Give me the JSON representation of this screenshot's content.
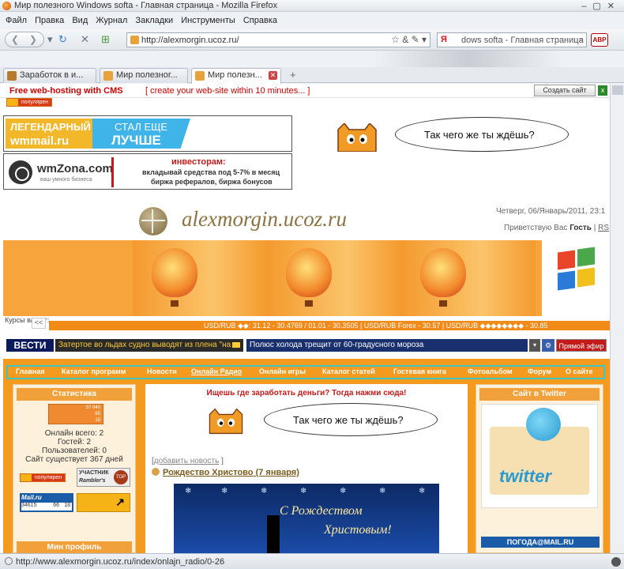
{
  "window": {
    "title": "Мир полезного Windows softa - Главная страница - Mozilla Firefox"
  },
  "menu": [
    "Файл",
    "Правка",
    "Вид",
    "Журнал",
    "Закладки",
    "Инструменты",
    "Справка"
  ],
  "toolbar": {
    "url": "http://alexmorgin.ucoz.ru/",
    "search_engine": "Я",
    "search_text": "dows softa - Главная страница",
    "abp": "ABP"
  },
  "tabs": [
    {
      "label": "Заработок в и...",
      "active": false
    },
    {
      "label": "Мир полезног...",
      "active": false
    },
    {
      "label": "Мир полезн...",
      "active": true
    }
  ],
  "hosting_bar": {
    "brand": "Free web-hosting with CMS",
    "tagline": "[ create your web-site within 10 minutes... ]",
    "create_button": "Создать сайт",
    "close": "x"
  },
  "badges": {
    "popular": "популярен"
  },
  "banner_wmmail": {
    "line1": "ЛЕГЕНДАРНЫЙ",
    "line2": "wmmail.ru",
    "line3": "СТАЛ ЕЩЕ",
    "line4": "ЛУЧШЕ"
  },
  "banner_wmzona": {
    "name": "wmZona.com",
    "tagline": "ваш умного бизнеса",
    "heading": "инвесторам:",
    "line1": "вкладывай средства под 5-7% в месяц",
    "line2": "биржа рефералов, биржа бонусов"
  },
  "speech_banner": {
    "text": "Так чего же ты ждёшь?"
  },
  "site": {
    "title": "alexmorgin.ucoz.ru",
    "date": "Четверг, 06/Январь/2011, 23:1",
    "greeting_prefix": "Приветствую Вас",
    "greeting_user": "Гость",
    "rss": "RS"
  },
  "rates": {
    "label": "Курсы валют:",
    "text": "USD/RUB ◆◆: 31.12 - 30.4769 / 01.01 - 30.3505 | USD/RUB Forex - 30.57 | USD/RUB ◆◆◆◆◆◆◆◆ - 30.85"
  },
  "news_ticker": {
    "logo": "ВЕСТИ",
    "item1": "Затертое во льдах судно выводят из плена \"на",
    "item2": "Полюс холода трещит от 60-градусного мороза",
    "live": "Прямой эфир"
  },
  "nav": [
    "Главная",
    "Каталог программ",
    "Новости",
    "Онлайн Радио",
    "Онлайн игры",
    "Каталог статей",
    "Гостевая книга",
    "Фотоальбом",
    "Форум",
    "О сайте"
  ],
  "stats": {
    "heading": "Статистика",
    "online_total": "Онлайн всего: 2",
    "guests": "Гостей: 2",
    "users": "Пользователей: 0",
    "uptime": "Сайт существует 367 дней",
    "counter_values": [
      "57 040",
      "65",
      "19"
    ],
    "rambler_label": "УЧАСТНИК",
    "rambler_name": "Rambler's",
    "rambler_top": "TOP 100",
    "mailru": "Mail.ru",
    "mailru_nums": [
      "34615",
      "66",
      "18"
    ],
    "next_heading": "Мин профиль"
  },
  "center": {
    "promo": "Ищешь где заработать деньги? Тогда нажми сюда!",
    "bubble": "Так чего же ты ждёшь?",
    "add_news": "добавить новость",
    "news_title": "Рождество Христово (7 января)",
    "card_line1": "С Рождеством",
    "card_line2": "Христовым!"
  },
  "right": {
    "heading": "Сайт в Twitter",
    "twitter": "twitter",
    "pogoda": "ПОГОДА@MAIL.RU"
  },
  "status": {
    "url": "http://www.alexmorgin.ucoz.ru/index/onlajn_radio/0-26"
  }
}
